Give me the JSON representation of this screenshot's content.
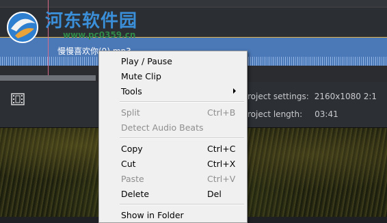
{
  "watermark": {
    "title": "河东软件园",
    "url": "www.pc0359.cn"
  },
  "timeline": {
    "clip_name": "慢慢喜欢你(9).mp3"
  },
  "status": {
    "settings_label": "roject settings:",
    "settings_value": "2160x1080 2:1",
    "length_label": "roject length:",
    "length_value": "03:41"
  },
  "context_menu": {
    "items": [
      {
        "label": "Play / Pause",
        "shortcut": "",
        "enabled": true
      },
      {
        "label": "Mute Clip",
        "shortcut": "",
        "enabled": true
      },
      {
        "label": "Tools",
        "shortcut": "",
        "enabled": true,
        "submenu": true
      },
      {
        "label": "Split",
        "shortcut": "Ctrl+B",
        "enabled": false
      },
      {
        "label": "Detect Audio Beats",
        "shortcut": "",
        "enabled": false
      },
      {
        "label": "Copy",
        "shortcut": "Ctrl+C",
        "enabled": true
      },
      {
        "label": "Cut",
        "shortcut": "Ctrl+X",
        "enabled": true
      },
      {
        "label": "Paste",
        "shortcut": "Ctrl+V",
        "enabled": false
      },
      {
        "label": "Delete",
        "shortcut": "Del",
        "enabled": true
      },
      {
        "label": "Show in Folder",
        "shortcut": "",
        "enabled": true
      }
    ]
  },
  "colors": {
    "clip_blue": "#4b78b6",
    "watermark_blue": "#3a8fd8",
    "watermark_green": "#2f8a4a",
    "menu_bg": "#f0f0f0"
  }
}
